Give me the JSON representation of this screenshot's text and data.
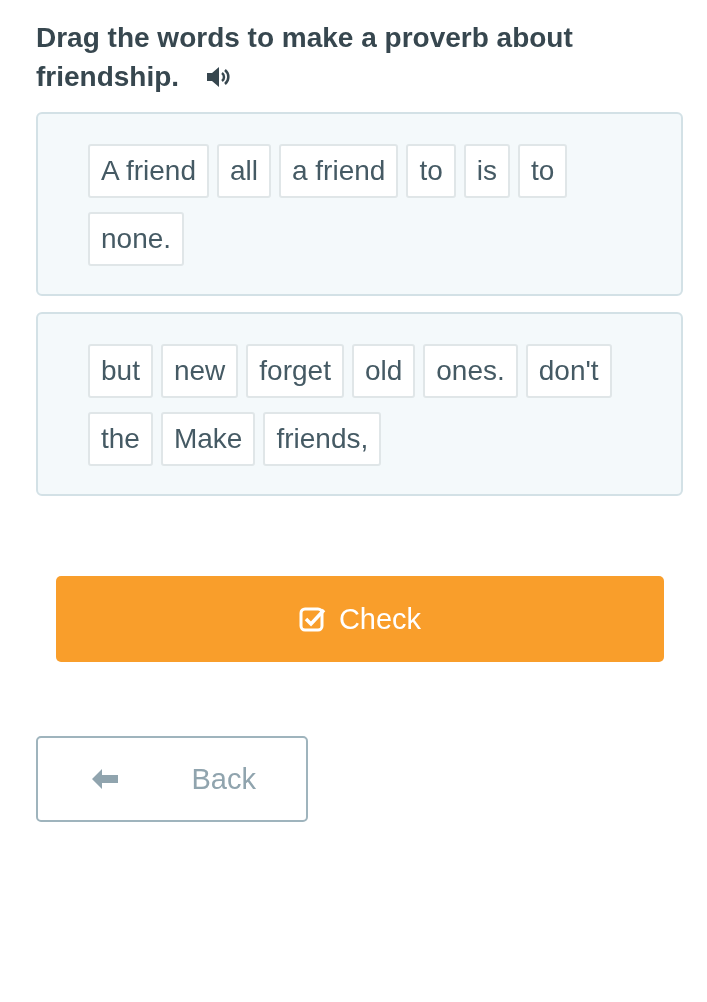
{
  "instruction": "Drag the words to make a proverb about friendship.",
  "groups": [
    {
      "words": [
        "A friend",
        "all",
        "a friend",
        "to",
        "is",
        "to",
        "none."
      ]
    },
    {
      "words": [
        "but",
        "new",
        "forget",
        "old",
        "ones.",
        "don't",
        "the",
        "Make",
        "friends,"
      ]
    }
  ],
  "check_button": {
    "label": "Check"
  },
  "back_button": {
    "label": "Back"
  }
}
